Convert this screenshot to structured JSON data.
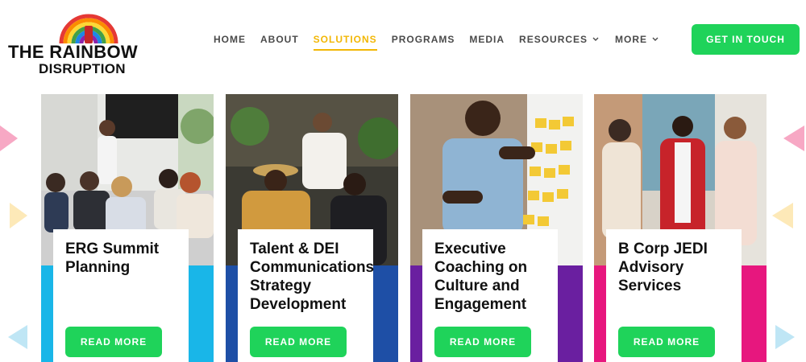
{
  "brand": {
    "line1": "THE RAINBOW",
    "line2": "DISRUPTION"
  },
  "nav": {
    "items": [
      {
        "label": "HOME",
        "active": false,
        "dropdown": false
      },
      {
        "label": "ABOUT",
        "active": false,
        "dropdown": false
      },
      {
        "label": "SOLUTIONS",
        "active": true,
        "dropdown": false
      },
      {
        "label": "PROGRAMS",
        "active": false,
        "dropdown": false
      },
      {
        "label": "MEDIA",
        "active": false,
        "dropdown": false
      },
      {
        "label": "RESOURCES",
        "active": false,
        "dropdown": true
      },
      {
        "label": "MORE",
        "active": false,
        "dropdown": true
      }
    ],
    "cta_label": "GET IN TOUCH"
  },
  "cards": [
    {
      "title": "ERG Summit Planning",
      "button": "READ MORE",
      "stripe_color": "#19b6e8"
    },
    {
      "title": "Talent & DEI Communications Strategy Development",
      "button": "READ MORE",
      "stripe_color": "#1e4fa6"
    },
    {
      "title": "Executive Coaching on Culture and Engagement",
      "button": "READ MORE",
      "stripe_color": "#6a1fa0"
    },
    {
      "title": "B Corp JEDI Advisory Services",
      "button": "READ MORE",
      "stripe_color": "#e7177e"
    }
  ],
  "colors": {
    "accent_green": "#1fd35a",
    "active_nav": "#f2b705",
    "nav_text": "#4a4a4a"
  }
}
